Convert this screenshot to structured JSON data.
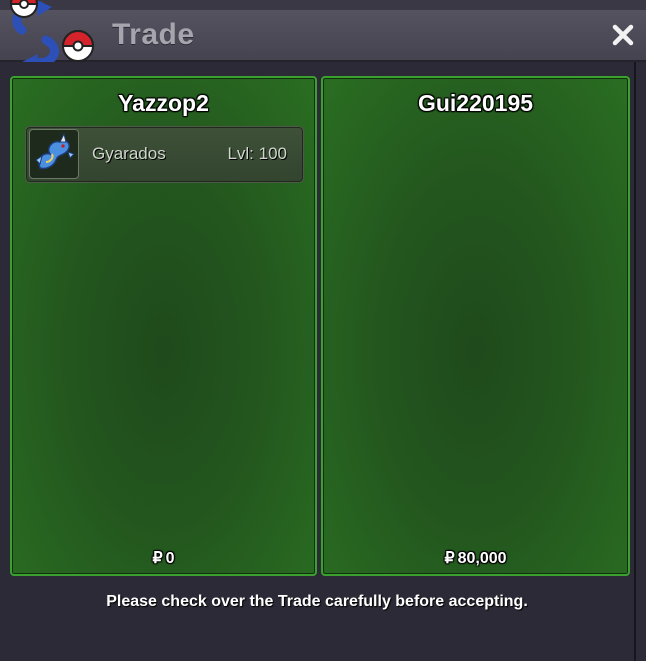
{
  "window": {
    "title": "Trade",
    "close_icon": "close-icon"
  },
  "left_panel": {
    "player_name": "Yazzop2",
    "pokemon": [
      {
        "name": "Gyarados",
        "level": "Lvl: 100",
        "icon": "gyarados-sprite-icon"
      }
    ],
    "currency_symbol": "₽",
    "money": "0"
  },
  "right_panel": {
    "player_name": "Gui220195",
    "pokemon": [],
    "currency_symbol": "₽",
    "money": "80,000"
  },
  "notice": "Please check over the Trade carefully before accepting.",
  "colors": {
    "panel_border": "#3aa12f",
    "panel_fill": "#23561e",
    "window_bg": "#2b2a36",
    "titlebar": "#4d4b57"
  }
}
